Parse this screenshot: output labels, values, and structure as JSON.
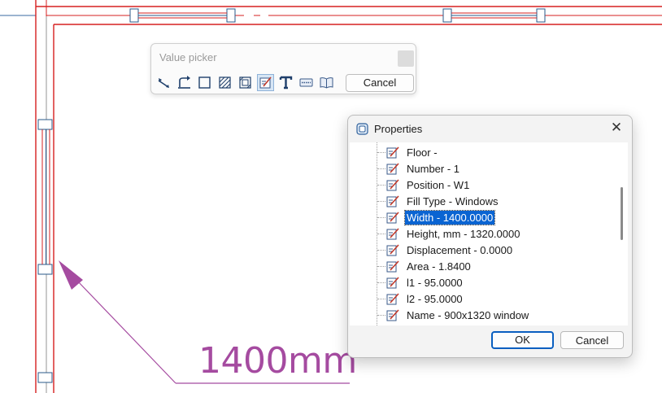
{
  "dimension": {
    "label": "1400mm"
  },
  "value_picker": {
    "title": "Value picker",
    "tools": [
      {
        "icon": "dimension-line-icon"
      },
      {
        "icon": "angle-arc-icon"
      },
      {
        "icon": "rectangle-icon"
      },
      {
        "icon": "hatch-icon"
      },
      {
        "icon": "section-hatch-icon"
      },
      {
        "icon": "object-properties-icon",
        "active": true
      },
      {
        "icon": "text-icon"
      },
      {
        "icon": "label-icon"
      },
      {
        "icon": "book-icon"
      }
    ],
    "cancel_label": "Cancel"
  },
  "properties": {
    "title": "Properties",
    "items": [
      {
        "label": "Floor -"
      },
      {
        "label": "Number - 1"
      },
      {
        "label": "Position - W1"
      },
      {
        "label": "Fill Type - Windows"
      },
      {
        "label": "Width - 1400.0000",
        "selected": true
      },
      {
        "label": "Height, mm - 1320.0000"
      },
      {
        "label": "Displacement - 0.0000"
      },
      {
        "label": "Area - 1.8400"
      },
      {
        "label": "l1 - 95.0000"
      },
      {
        "label": "l2 - 95.0000"
      },
      {
        "label": "Name - 900x1320 window"
      }
    ],
    "ok_label": "OK",
    "cancel_label": "Cancel"
  },
  "colors": {
    "wall": "#d62020",
    "window": "#2a5a8a",
    "leader": "#a54ba0",
    "selection": "#0a64d2"
  }
}
